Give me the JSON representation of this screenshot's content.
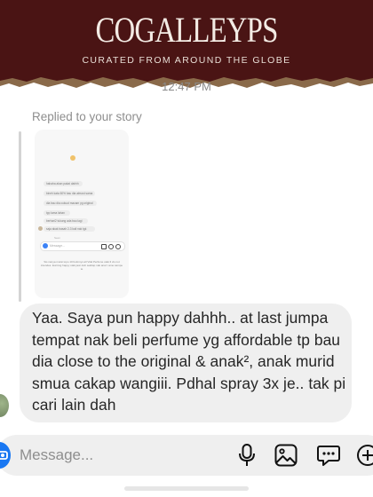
{
  "banner": {
    "title": "COGALLEYPS",
    "subtitle": "CURATED FROM AROUND THE GLOBE"
  },
  "status": {
    "time": "12:47 PM"
  },
  "thread": {
    "replied_label": "Replied to your story",
    "story_preview": {
      "bubbles": [
        "hahaha akan pakai dahhh",
        "bineh kata 60% bau dia almost sama",
        "dia bau dia cukuut macam yg original",
        "tpp lama lahan",
        "berhari2 tukung ada bau lagi",
        "saja akak basah 2-3 kali nak tgk"
      ],
      "seen_text": "Seen",
      "input_placeholder": "Message...",
      "footer": "Sis nanya murai topo 10 botinnys all Vital Perfume utak Il vis not intendes. Eurning happy utak jaun kub sekitap nak anar t ame sampe te"
    },
    "message": "Yaa. Saya pun happy dahhh.. at last jumpa tempat nak beli perfume yg affordable tp bau dia close to the original & anak², anak murid smua cakap wangiii. Pdhal spray 3x je.. tak pi cari lain dah"
  },
  "composer": {
    "placeholder": "Message...",
    "icons": [
      "camera-icon",
      "microphone-icon",
      "gallery-icon",
      "sticker-icon",
      "add-icon"
    ]
  },
  "colors": {
    "banner": "#4a1414",
    "bubble": "#efefef",
    "accent": "#1877f2"
  }
}
